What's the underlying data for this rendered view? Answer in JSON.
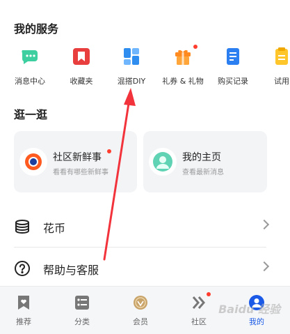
{
  "services": {
    "title": "我的服务",
    "items": [
      {
        "label": "消息中心",
        "icon": "message-bubble-icon"
      },
      {
        "label": "收藏夹",
        "icon": "bookmark-icon"
      },
      {
        "label": "混搭DIY",
        "icon": "layout-blocks-icon"
      },
      {
        "label": "礼券 & 礼物",
        "icon": "gift-icon"
      },
      {
        "label": "购买记录",
        "icon": "document-icon"
      },
      {
        "label": "试用",
        "icon": "trial-icon"
      }
    ]
  },
  "browse": {
    "title": "逛一逛",
    "cards": [
      {
        "title": "社区新鲜事",
        "subtitle": "看看有哪些新鲜事"
      },
      {
        "title": "我的主页",
        "subtitle": "查看最新消息"
      }
    ]
  },
  "menu": {
    "items": [
      {
        "label": "花币",
        "icon": "coin-stack-icon"
      },
      {
        "label": "帮助与客服",
        "icon": "help-circle-icon"
      }
    ]
  },
  "tabs": [
    {
      "label": "推荐",
      "icon": "bookmark-heart-icon"
    },
    {
      "label": "分类",
      "icon": "category-list-icon"
    },
    {
      "label": "会员",
      "icon": "member-badge-icon"
    },
    {
      "label": "社区",
      "icon": "chevron-double-icon"
    },
    {
      "label": "我的",
      "icon": "user-icon",
      "active": true
    }
  ],
  "watermark": "Baidu 经验",
  "colors": {
    "accent": "#1a5ae6",
    "notify": "#ff3d2e",
    "arrow": "#f2333b"
  }
}
